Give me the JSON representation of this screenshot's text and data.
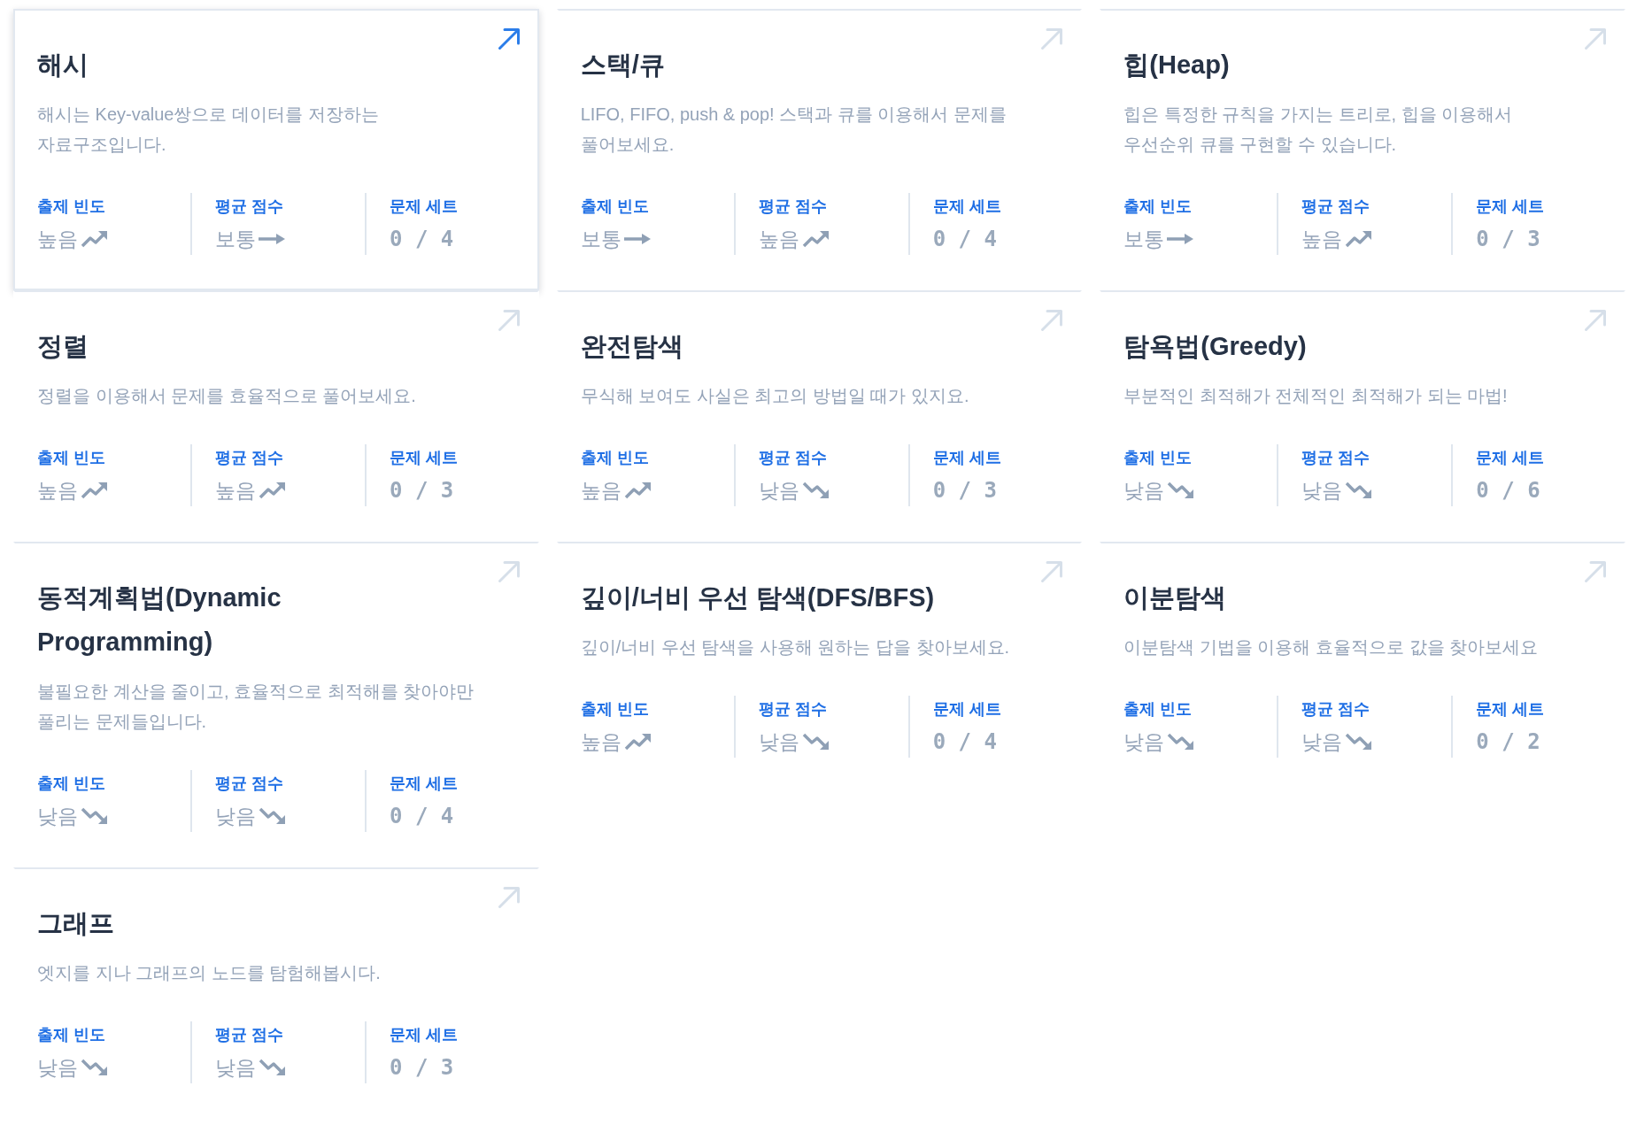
{
  "cards": [
    {
      "title": "해시",
      "description": "해시는 Key-value쌍으로 데이터를 저장하는 자료구조입니다.",
      "hovered": true,
      "stats": [
        {
          "kind": "rising",
          "label": "출제 빈도",
          "value": "높음"
        },
        {
          "kind": "steady",
          "label": "평균 점수",
          "value": "보통"
        },
        {
          "kind": "count",
          "label": "문제 세트",
          "value": "0 / 4"
        }
      ]
    },
    {
      "title": "스택/큐",
      "description": "LIFO, FIFO, push & pop! 스택과 큐를 이용해서 문제를 풀어보세요.",
      "hovered": false,
      "stats": [
        {
          "kind": "steady",
          "label": "출제 빈도",
          "value": "보통"
        },
        {
          "kind": "rising",
          "label": "평균 점수",
          "value": "높음"
        },
        {
          "kind": "count",
          "label": "문제 세트",
          "value": "0 / 4"
        }
      ]
    },
    {
      "title": "힙(Heap)",
      "description": "힙은 특정한 규칙을 가지는 트리로, 힙을 이용해서 우선순위 큐를 구현할 수 있습니다.",
      "hovered": false,
      "stats": [
        {
          "kind": "steady",
          "label": "출제 빈도",
          "value": "보통"
        },
        {
          "kind": "rising",
          "label": "평균 점수",
          "value": "높음"
        },
        {
          "kind": "count",
          "label": "문제 세트",
          "value": "0 / 3"
        }
      ]
    },
    {
      "title": "정렬",
      "description": "정렬을 이용해서 문제를 효율적으로 풀어보세요.",
      "hovered": false,
      "stats": [
        {
          "kind": "rising",
          "label": "출제 빈도",
          "value": "높음"
        },
        {
          "kind": "rising",
          "label": "평균 점수",
          "value": "높음"
        },
        {
          "kind": "count",
          "label": "문제 세트",
          "value": "0 / 3"
        }
      ]
    },
    {
      "title": "완전탐색",
      "description": "무식해 보여도 사실은 최고의 방법일 때가 있지요.",
      "hovered": false,
      "stats": [
        {
          "kind": "rising",
          "label": "출제 빈도",
          "value": "높음"
        },
        {
          "kind": "falling",
          "label": "평균 점수",
          "value": "낮음"
        },
        {
          "kind": "count",
          "label": "문제 세트",
          "value": "0 / 3"
        }
      ]
    },
    {
      "title": "탐욕법(Greedy)",
      "description": "부분적인 최적해가 전체적인 최적해가 되는 마법!",
      "hovered": false,
      "stats": [
        {
          "kind": "falling",
          "label": "출제 빈도",
          "value": "낮음"
        },
        {
          "kind": "falling",
          "label": "평균 점수",
          "value": "낮음"
        },
        {
          "kind": "count",
          "label": "문제 세트",
          "value": "0 / 6"
        }
      ]
    },
    {
      "title": "동적계획법(Dynamic Programming)",
      "description": "불필요한 계산을 줄이고, 효율적으로 최적해를 찾아야만 풀리는 문제들입니다.",
      "hovered": false,
      "stats": [
        {
          "kind": "falling",
          "label": "출제 빈도",
          "value": "낮음"
        },
        {
          "kind": "falling",
          "label": "평균 점수",
          "value": "낮음"
        },
        {
          "kind": "count",
          "label": "문제 세트",
          "value": "0 / 4"
        }
      ]
    },
    {
      "title": "깊이/너비 우선 탐색(DFS/BFS)",
      "description": "깊이/너비 우선 탐색을 사용해 원하는 답을 찾아보세요.",
      "hovered": false,
      "stats": [
        {
          "kind": "rising",
          "label": "출제 빈도",
          "value": "높음"
        },
        {
          "kind": "falling",
          "label": "평균 점수",
          "value": "낮음"
        },
        {
          "kind": "count",
          "label": "문제 세트",
          "value": "0 / 4"
        }
      ]
    },
    {
      "title": "이분탐색",
      "description": "이분탐색 기법을 이용해 효율적으로 값을 찾아보세요",
      "hovered": false,
      "stats": [
        {
          "kind": "falling",
          "label": "출제 빈도",
          "value": "낮음"
        },
        {
          "kind": "falling",
          "label": "평균 점수",
          "value": "낮음"
        },
        {
          "kind": "count",
          "label": "문제 세트",
          "value": "0 / 2"
        }
      ]
    },
    {
      "title": "그래프",
      "description": "엣지를 지나 그래프의 노드를 탐험해봅시다.",
      "hovered": false,
      "stats": [
        {
          "kind": "falling",
          "label": "출제 빈도",
          "value": "낮음"
        },
        {
          "kind": "falling",
          "label": "평균 점수",
          "value": "낮음"
        },
        {
          "kind": "count",
          "label": "문제 세트",
          "value": "0 / 3"
        }
      ]
    }
  ]
}
